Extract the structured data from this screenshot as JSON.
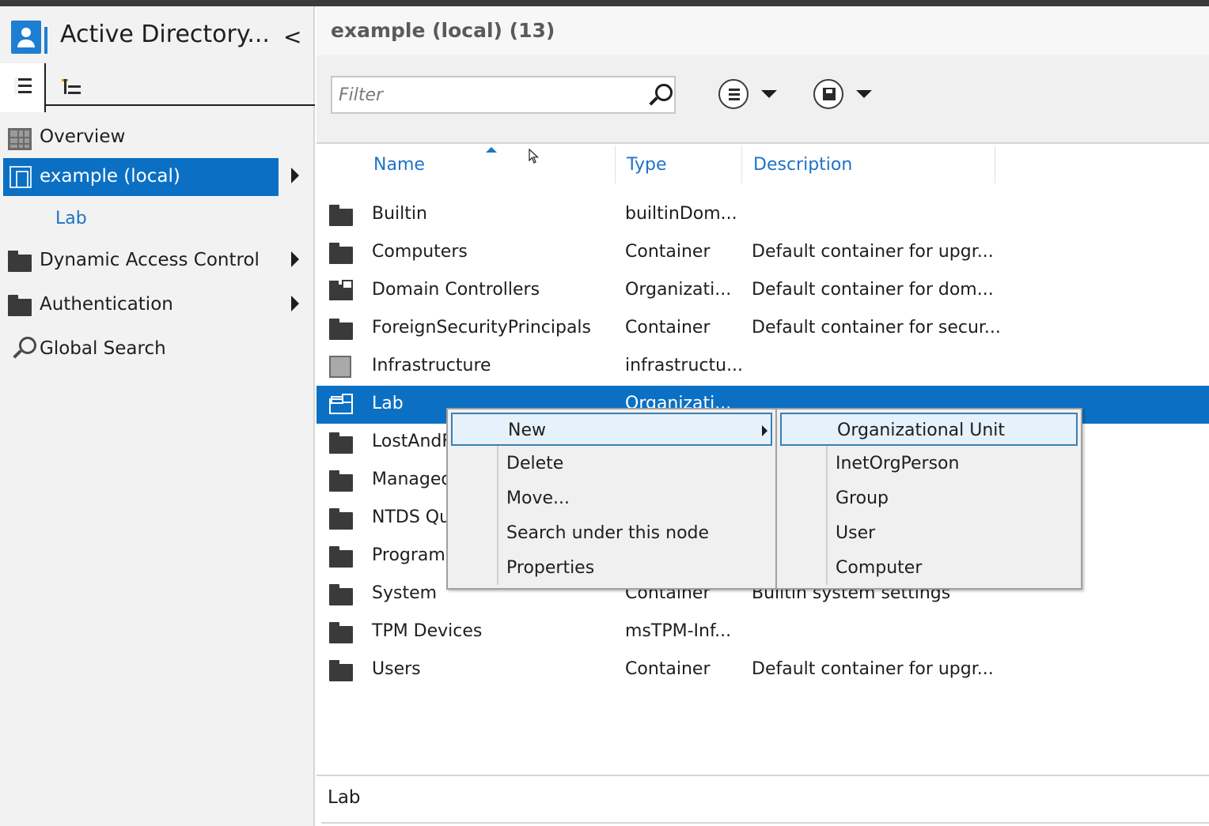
{
  "app": {
    "title": "Active Directory...",
    "collapse_glyph": "<"
  },
  "nav": {
    "items": [
      {
        "label": "Overview",
        "icon": "overview-icon"
      },
      {
        "label": "example (local)",
        "icon": "domain-icon",
        "selected": true
      },
      {
        "label": "Lab",
        "icon": ""
      },
      {
        "label": "Dynamic Access Control",
        "icon": "folder-icon"
      },
      {
        "label": "Authentication",
        "icon": "folder-icon"
      },
      {
        "label": "Global Search",
        "icon": "search-icon"
      }
    ]
  },
  "main": {
    "title": "example (local)  (13)",
    "filter_placeholder": "Filter",
    "columns": [
      "Name",
      "Type",
      "Description"
    ],
    "rows": [
      {
        "name": "Builtin",
        "type": "builtinDom...",
        "description": "",
        "icon": "folder-icon"
      },
      {
        "name": "Computers",
        "type": "Container",
        "description": "Default container for upgr...",
        "icon": "folder-icon"
      },
      {
        "name": "Domain Controllers",
        "type": "Organizati...",
        "description": "Default container for dom...",
        "icon": "ou-icon"
      },
      {
        "name": "ForeignSecurityPrincipals",
        "type": "Container",
        "description": "Default container for secur...",
        "icon": "folder-icon"
      },
      {
        "name": "Infrastructure",
        "type": "infrastructu...",
        "description": "",
        "icon": "infrastructure-icon"
      },
      {
        "name": "Lab",
        "type": "Organizati...",
        "description": "",
        "icon": "ou-icon",
        "selected": true
      },
      {
        "name": "LostAndF",
        "type": "",
        "description": "",
        "icon": "folder-icon"
      },
      {
        "name": "Managed",
        "type": "",
        "description": "",
        "icon": "folder-icon"
      },
      {
        "name": "NTDS Qu",
        "type": "",
        "description": "",
        "icon": "folder-icon"
      },
      {
        "name": "Program",
        "type": "",
        "description": "",
        "icon": "folder-icon"
      },
      {
        "name": "System",
        "type": "Container",
        "description": "Builtin system settings",
        "icon": "folder-icon"
      },
      {
        "name": "TPM Devices",
        "type": "msTPM-Inf...",
        "description": "",
        "icon": "folder-icon"
      },
      {
        "name": "Users",
        "type": "Container",
        "description": "Default container for upgr...",
        "icon": "folder-icon"
      }
    ],
    "status": "Lab"
  },
  "context_menu": {
    "items": [
      "New",
      "Delete",
      "Move...",
      "Search under this node",
      "Properties"
    ]
  },
  "submenu": {
    "items": [
      "Organizational Unit",
      "InetOrgPerson",
      "Group",
      "User",
      "Computer"
    ]
  },
  "colors": {
    "accent": "#0b70c4",
    "header_link": "#1e73c8",
    "menu_highlight": "#e5f1fb"
  }
}
